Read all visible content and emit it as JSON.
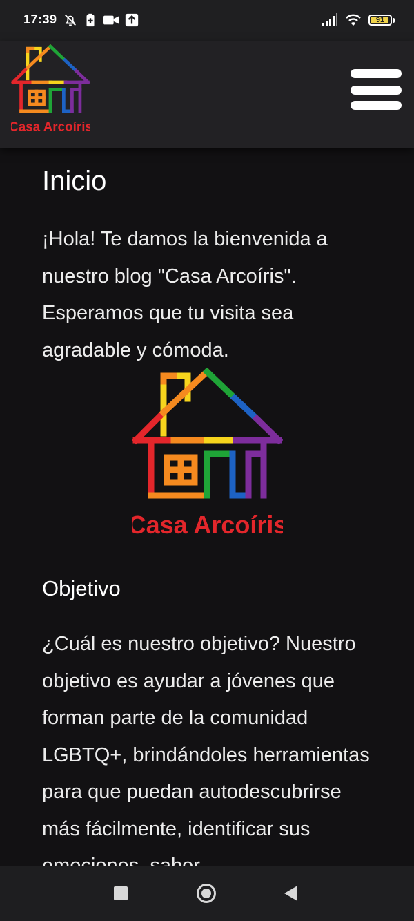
{
  "status_bar": {
    "time": "17:39",
    "battery_level": "91",
    "icons": [
      "bell-off-icon",
      "battery-saver-icon",
      "video-camera-icon",
      "upload-icon",
      "signal-icon",
      "wifi-icon",
      "battery-icon"
    ]
  },
  "header": {
    "logo_text": "Casa Arcoíris",
    "menu_icon": "hamburger-menu-icon"
  },
  "page": {
    "title": "Inicio",
    "intro": "¡Hola! Te damos la bienvenida a nuestro blog \"Casa Arcoíris\". Esperamos que tu visita sea agradable y cómoda.",
    "logo_text": "Casa Arcoíris",
    "section_title": "Objetivo",
    "objective": "¿Cuál es nuestro objetivo? Nuestro objetivo es ayudar a jóvenes que forman parte de la comunidad LGBTQ+, brindándoles herramientas para que puedan autodescubrirse más fácilmente, identificar sus emociones, saber"
  },
  "nav_bar": {
    "icons": [
      "recent-apps-icon",
      "home-icon",
      "back-icon"
    ]
  },
  "colors": {
    "background": "#121113",
    "header": "#222124",
    "red": "#e3262b",
    "orange": "#f58a1f",
    "yellow": "#f7d51d",
    "green": "#1fa437",
    "blue": "#1d62c4",
    "purple": "#7d2d9c"
  }
}
